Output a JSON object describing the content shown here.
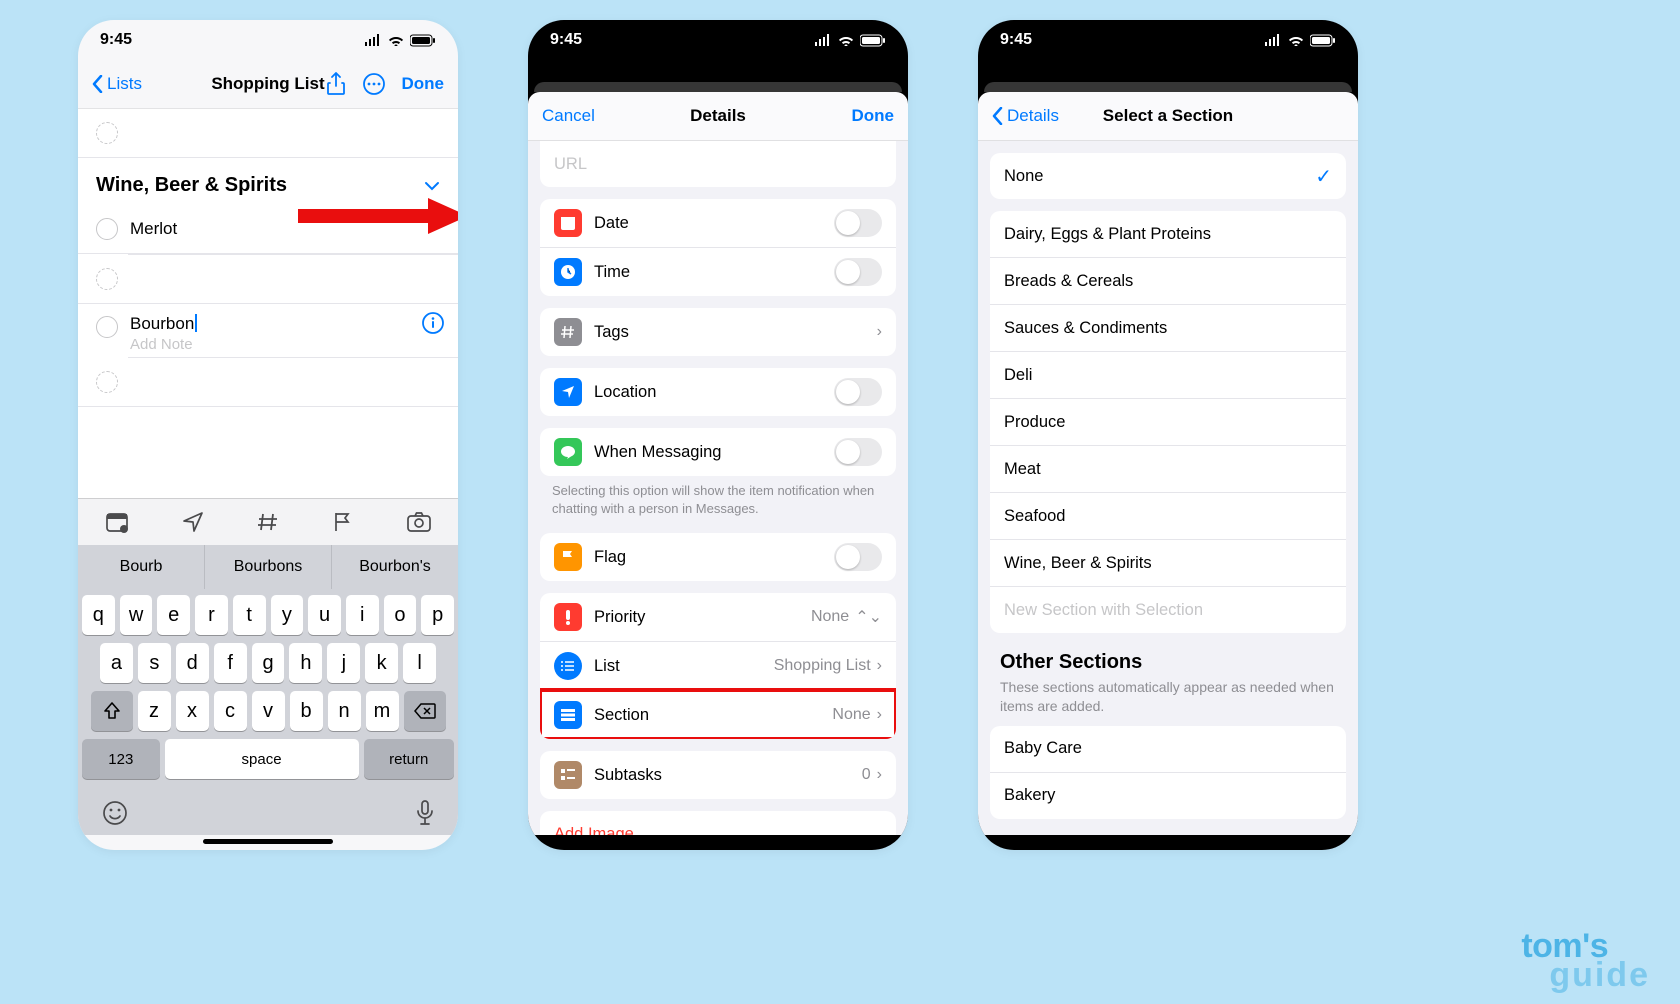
{
  "status_time": "9:45",
  "phone1": {
    "nav": {
      "back": "Lists",
      "title": "Shopping List",
      "done": "Done"
    },
    "section_header": "Wine, Beer & Spirits",
    "items": [
      "Merlot"
    ],
    "editing_item": "Bourbon",
    "add_note_placeholder": "Add Note",
    "suggestions": [
      "Bourb",
      "Bourbons",
      "Bourbon's"
    ],
    "key_rows": [
      [
        "q",
        "w",
        "e",
        "r",
        "t",
        "y",
        "u",
        "i",
        "o",
        "p"
      ],
      [
        "a",
        "s",
        "d",
        "f",
        "g",
        "h",
        "j",
        "k",
        "l"
      ],
      [
        "z",
        "x",
        "c",
        "v",
        "b",
        "n",
        "m"
      ]
    ],
    "num_key": "123",
    "space_key": "space",
    "return_key": "return"
  },
  "phone2": {
    "nav": {
      "cancel": "Cancel",
      "title": "Details",
      "done": "Done"
    },
    "url_placeholder": "URL",
    "rows": {
      "date": "Date",
      "time": "Time",
      "tags": "Tags",
      "location": "Location",
      "messaging": "When Messaging",
      "messaging_footer": "Selecting this option will show the item notification when chatting with a person in Messages.",
      "flag": "Flag",
      "priority": "Priority",
      "priority_val": "None",
      "list": "List",
      "list_val": "Shopping List",
      "section": "Section",
      "section_val": "None",
      "subtasks": "Subtasks",
      "subtasks_val": "0",
      "add_image": "Add Image"
    }
  },
  "phone3": {
    "nav": {
      "back": "Details",
      "title": "Select a Section"
    },
    "none": "None",
    "sections": [
      "Dairy, Eggs & Plant Proteins",
      "Breads & Cereals",
      "Sauces & Condiments",
      "Deli",
      "Produce",
      "Meat",
      "Seafood",
      "Wine, Beer & Spirits"
    ],
    "new_section": "New Section with Selection",
    "other_header": "Other Sections",
    "other_sub": "These sections automatically appear as needed when items are added.",
    "other": [
      "Baby Care",
      "Bakery"
    ]
  },
  "watermark": {
    "l1": "tom's",
    "l2": "guide"
  }
}
